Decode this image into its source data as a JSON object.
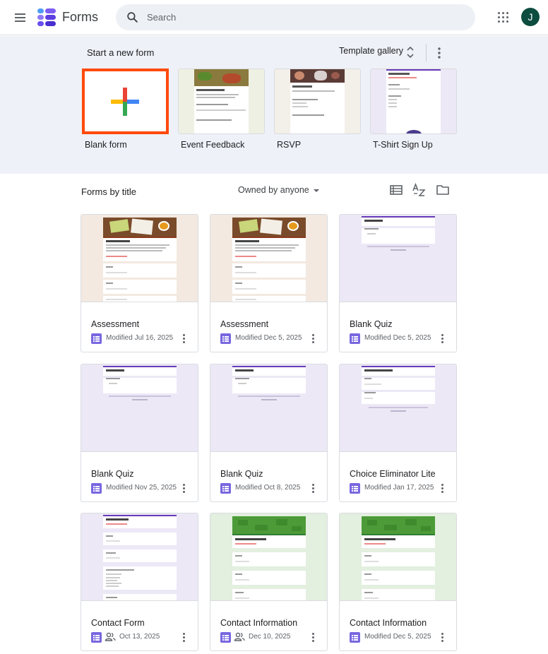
{
  "header": {
    "app_title": "Forms",
    "search_placeholder": "Search",
    "avatar_initial": "J",
    "icons": [
      "menu-icon",
      "forms-logo-icon",
      "search-icon",
      "apps-icon"
    ]
  },
  "templates": {
    "section_label": "Start a new form",
    "gallery_label": "Template gallery",
    "items": [
      {
        "label": "Blank form"
      },
      {
        "label": "Event Feedback"
      },
      {
        "label": "RSVP"
      },
      {
        "label": "T-Shirt Sign Up"
      }
    ]
  },
  "list": {
    "title": "Forms by title",
    "owner_filter": "Owned by anyone",
    "tool_icons": [
      "list-view-icon",
      "sort-az-icon",
      "folder-icon"
    ]
  },
  "forms": [
    {
      "title": "Assessment",
      "date": "Modified Jul 16, 2025",
      "thumb": "beige",
      "shared": false
    },
    {
      "title": "Assessment",
      "date": "Modified Dec 5, 2025",
      "thumb": "beige",
      "shared": false
    },
    {
      "title": "Blank Quiz",
      "date": "Modified Dec 5, 2025",
      "thumb": "lilac",
      "shared": false
    },
    {
      "title": "Blank Quiz",
      "date": "Modified Nov 25, 2025",
      "thumb": "lilac",
      "shared": false
    },
    {
      "title": "Blank Quiz",
      "date": "Modified Oct 8, 2025",
      "thumb": "lilac",
      "shared": false
    },
    {
      "title": "Choice Eliminator Lite",
      "date": "Modified Jan 17, 2025",
      "thumb": "lilac",
      "shared": false
    },
    {
      "title": "Contact Form",
      "date": "Oct 13, 2025",
      "thumb": "lilac",
      "shared": true
    },
    {
      "title": "Contact Information",
      "date": "Dec 10, 2025",
      "thumb": "green",
      "shared": true
    },
    {
      "title": "Contact Information",
      "date": "Modified Dec 5, 2025",
      "thumb": "green",
      "shared": false
    }
  ],
  "colors": {
    "band": "#eef1f7",
    "form_icon": "#7867e0",
    "blank_highlight": "#ff4a0d",
    "avatar": "#0d4d3f"
  }
}
